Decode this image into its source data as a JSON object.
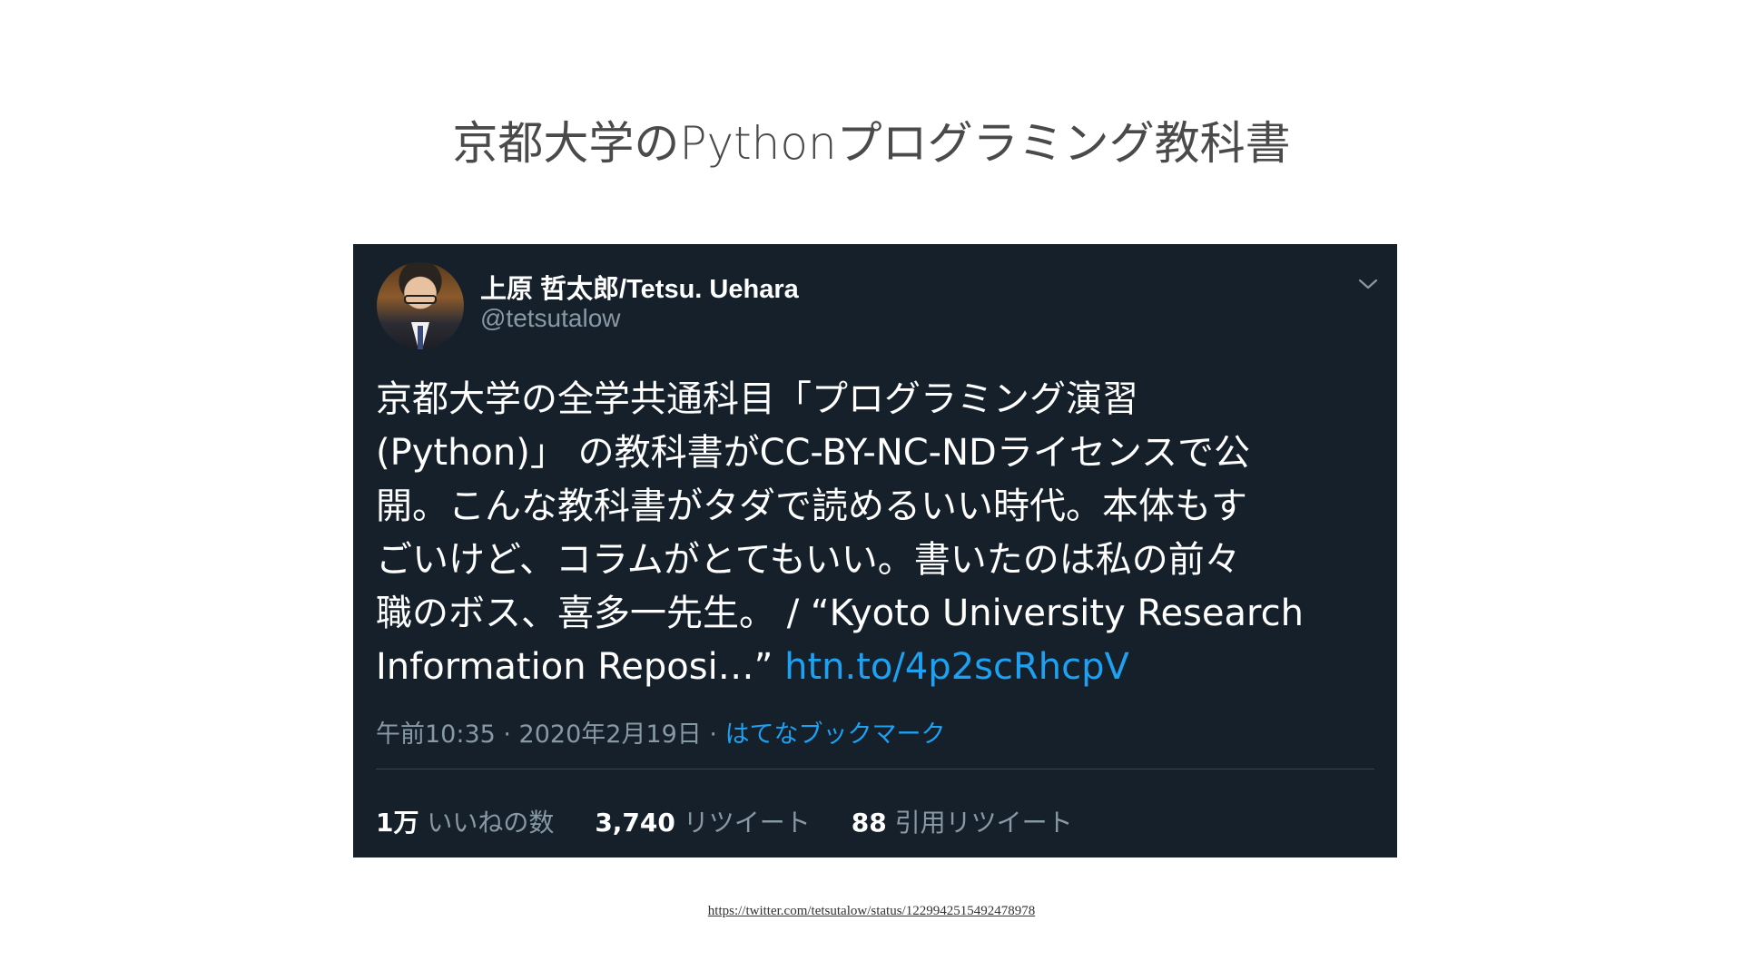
{
  "slide": {
    "title": "京都大学のPythonプログラミング教科書",
    "source_url": "https://twitter.com/tetsutalow/status/1229942515492478978"
  },
  "tweet": {
    "display_name": "上原 哲太郎/Tetsu. Uehara",
    "handle": "@tetsutalow",
    "avatar_icon": "user-avatar",
    "menu_icon": "chevron-down-icon",
    "text_lines": [
      "京都大学の全学共通科目「プログラミング演習",
      "(Python)」 の教科書がCC-BY-NC-NDライセンスで公",
      "開。こんな教科書がタダで読めるいい時代。本体もす",
      "ごいけど、コラムがとてもいい。書いたのは私の前々",
      "職のボス、喜多一先生。 / “Kyoto University Research"
    ],
    "last_line_text": "Information Reposi…” ",
    "link_text": "htn.to/4p2scRhcpV",
    "timestamp": "午前10:35 · 2020年2月19日 · ",
    "via": "はてなブックマーク",
    "stats": {
      "likes_count": "1万",
      "likes_label": "いいねの数",
      "retweets_count": "3,740",
      "retweets_label": "リツイート",
      "quotes_count": "88",
      "quotes_label": "引用リツイート"
    },
    "colors": {
      "background": "#15202b",
      "link": "#1da1f2",
      "secondary_text": "#8899a6"
    }
  }
}
